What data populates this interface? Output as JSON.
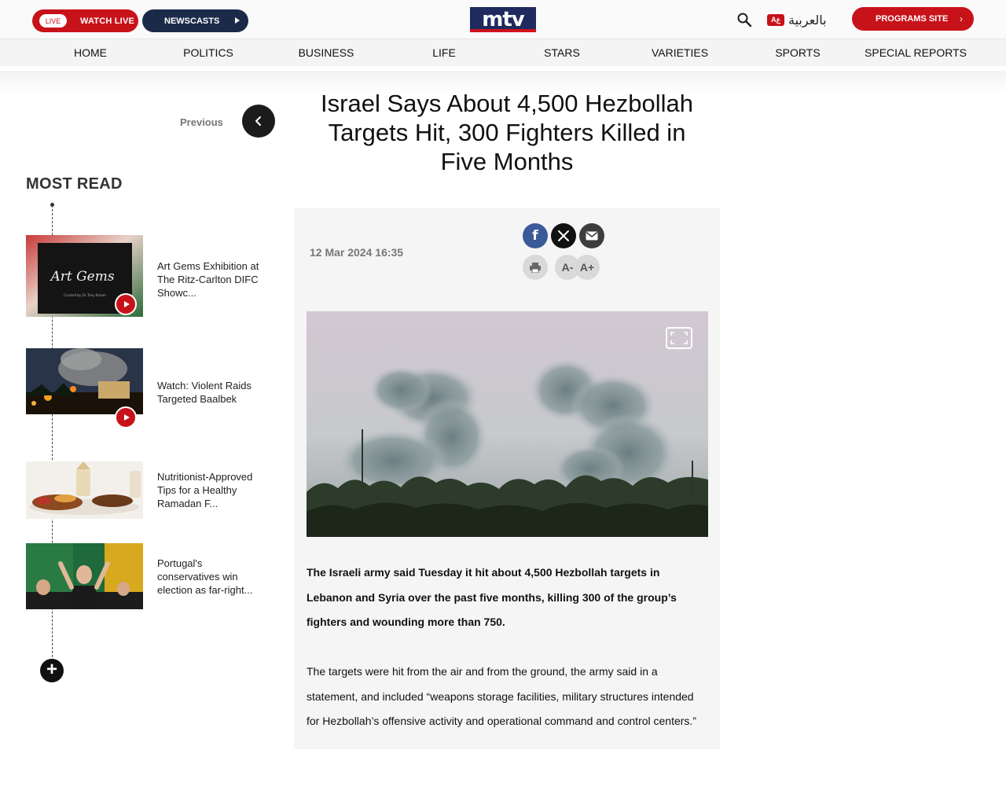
{
  "header": {
    "live_badge": "LIVE",
    "watch_live": "WATCH LIVE",
    "newscasts": "NEWSCASTS",
    "logo": "mtv",
    "arabic_badge": "Aع",
    "arabic_label": "بالعربية",
    "programs_site": "PROGRAMS SITE",
    "search_icon": "search-icon",
    "brand_color": "#c8121a",
    "navy_color": "#1c2a4a"
  },
  "nav": {
    "items": [
      "HOME",
      "POLITICS",
      "BUSINESS",
      "LIFE",
      "STARS",
      "VARIETIES",
      "SPORTS",
      "SPECIAL REPORTS"
    ]
  },
  "previous_label": "Previous",
  "article": {
    "title": "Israel Says About 4,500 Hezbollah Targets Hit, 300 Fighters Killed in Five Months",
    "date": "12 Mar 2024 16:35",
    "share_icons": [
      "facebook-icon",
      "x-icon",
      "email-icon"
    ],
    "tools": {
      "print_icon": "print-icon",
      "font_decrease": "A-",
      "font_increase": "A+"
    },
    "lead": "The Israeli army said Tuesday it hit about 4,500 Hezbollah targets in Lebanon and Syria over the past five months, killing 300 of the group’s fighters and wounding more than 750.",
    "body": "The targets were hit from the air and from the ground, the army said in a statement, and included “weapons storage facilities, military structures intended for Hezbollah’s offensive activity and operational command and control centers.”"
  },
  "most_read": {
    "title": "MOST READ",
    "items": [
      {
        "text": "Art Gems Exhibition at The Ritz-Carlton DIFC Showc...",
        "has_video": true,
        "thumb_text": "Art Gems",
        "thumb_caption": "Curated by Dr. Tony Karam"
      },
      {
        "text": "Watch: Violent Raids Targeted Baalbek",
        "has_video": true
      },
      {
        "text": "Nutritionist-Approved Tips for a Healthy Ramadan F...",
        "has_video": false
      },
      {
        "text": "Portugal's conservatives win election as far-right...",
        "has_video": false
      }
    ],
    "more_icon": "plus-icon"
  }
}
